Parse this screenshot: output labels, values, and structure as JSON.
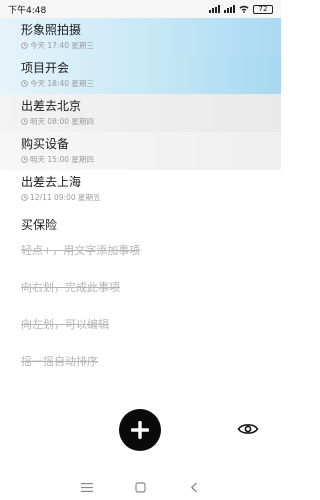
{
  "status_bar": {
    "time": "下午4:48",
    "battery": "72"
  },
  "tasks": [
    {
      "title": "形象照拍摄",
      "meta": "今天 17:40 星期三"
    },
    {
      "title": "项目开会",
      "meta": "今天 18:40 星期三"
    },
    {
      "title": "出差去北京",
      "meta": "明天 08:00 星期四"
    },
    {
      "title": "购买设备",
      "meta": "明天 15:00 星期四"
    },
    {
      "title": "出差去上海",
      "meta": "12/11 09:00 星期五"
    },
    {
      "title": "买保险"
    }
  ],
  "hints": [
    "轻点+，用文字添加事项",
    "向右划，完成此事项",
    "向左划，可以编辑",
    "摇一摇自动排序"
  ],
  "icons": {
    "add": "plus-icon",
    "eye": "eye-icon",
    "clock": "clock-icon",
    "nav_menu": "menu-icon",
    "nav_home": "square-icon",
    "nav_back": "back-icon"
  },
  "colors": {
    "accent": "#0a0a0a",
    "highlight": "#a9daf1",
    "hint": "#b5b5b5"
  }
}
